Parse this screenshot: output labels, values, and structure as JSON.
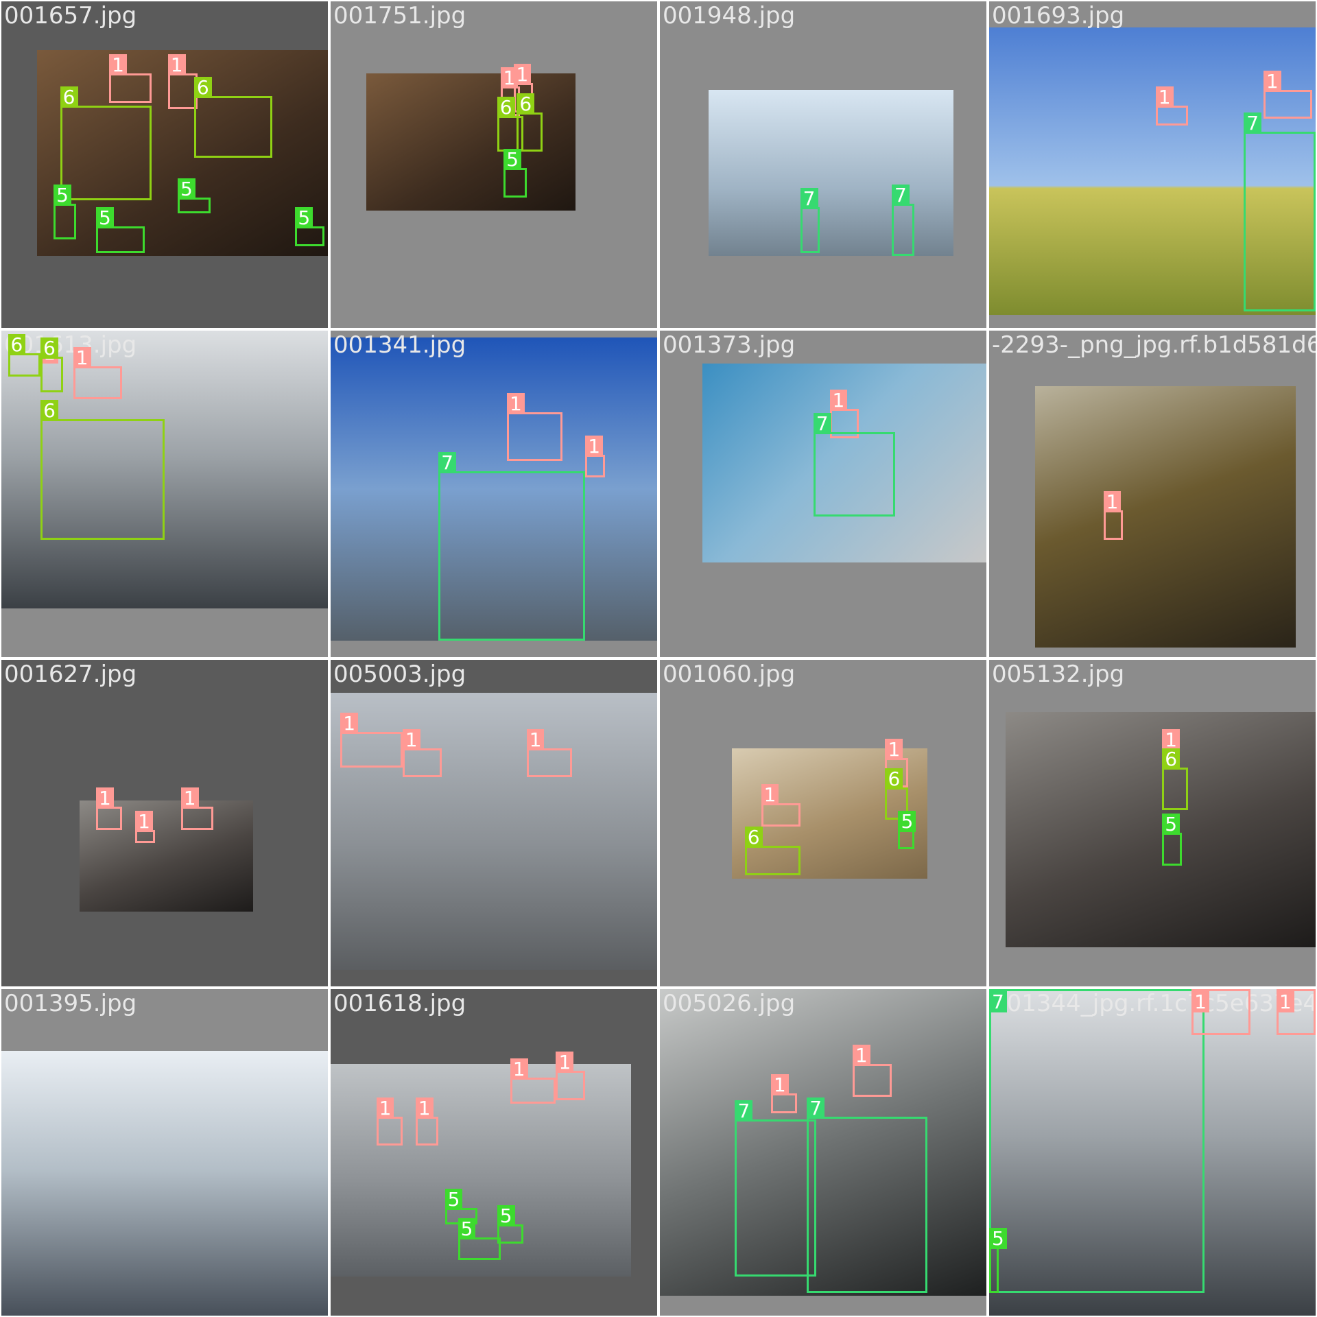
{
  "class_colors": {
    "1": "#ff9a95",
    "5": "#3ddb2e",
    "6": "#8fd114",
    "7": "#36da70"
  },
  "tiles": [
    {
      "name": "001657.jpg",
      "dark": true,
      "photo": [
        0.11,
        0.15,
        1.0,
        0.78
      ],
      "scene": "warm",
      "boxes": [
        {
          "c": "1",
          "b": [
            0.33,
            0.22,
            0.46,
            0.31
          ]
        },
        {
          "c": "1",
          "b": [
            0.51,
            0.22,
            0.6,
            0.33
          ]
        },
        {
          "c": "6",
          "b": [
            0.18,
            0.32,
            0.46,
            0.61
          ]
        },
        {
          "c": "6",
          "b": [
            0.59,
            0.29,
            0.83,
            0.48
          ]
        },
        {
          "c": "5",
          "b": [
            0.16,
            0.62,
            0.23,
            0.73
          ]
        },
        {
          "c": "5",
          "b": [
            0.29,
            0.69,
            0.44,
            0.77
          ]
        },
        {
          "c": "5",
          "b": [
            0.54,
            0.6,
            0.64,
            0.65
          ]
        },
        {
          "c": "5",
          "b": [
            0.9,
            0.69,
            0.99,
            0.75
          ]
        }
      ]
    },
    {
      "name": "001751.jpg",
      "dark": false,
      "photo": [
        0.11,
        0.22,
        0.75,
        0.64
      ],
      "scene": "warm",
      "boxes": [
        {
          "c": "1",
          "b": [
            0.52,
            0.26,
            0.58,
            0.35
          ]
        },
        {
          "c": "1",
          "b": [
            0.56,
            0.25,
            0.62,
            0.34
          ]
        },
        {
          "c": "6",
          "b": [
            0.51,
            0.35,
            0.59,
            0.46
          ]
        },
        {
          "c": "6",
          "b": [
            0.57,
            0.34,
            0.65,
            0.46
          ]
        },
        {
          "c": "5",
          "b": [
            0.53,
            0.51,
            0.6,
            0.6
          ]
        }
      ]
    },
    {
      "name": "001948.jpg",
      "dark": false,
      "photo": [
        0.15,
        0.27,
        0.9,
        0.78
      ],
      "scene": "light",
      "boxes": [
        {
          "c": "7",
          "b": [
            0.43,
            0.63,
            0.49,
            0.77
          ]
        },
        {
          "c": "7",
          "b": [
            0.71,
            0.62,
            0.78,
            0.78
          ]
        }
      ]
    },
    {
      "name": "001693.jpg",
      "dark": false,
      "photo": [
        0.0,
        0.08,
        1.0,
        0.96
      ],
      "scene": "sky",
      "boxes": [
        {
          "c": "1",
          "b": [
            0.51,
            0.32,
            0.61,
            0.38
          ]
        },
        {
          "c": "1",
          "b": [
            0.84,
            0.27,
            0.99,
            0.36
          ]
        },
        {
          "c": "7",
          "b": [
            0.78,
            0.4,
            1.0,
            0.95
          ]
        }
      ]
    },
    {
      "name": "001613.jpg",
      "dark": false,
      "photo": [
        0.0,
        0.0,
        1.0,
        0.85
      ],
      "scene": "site",
      "boxes": [
        {
          "c": "6",
          "b": [
            0.02,
            0.07,
            0.12,
            0.14
          ]
        },
        {
          "c": "1",
          "b": [
            0.12,
            0.03,
            0.17,
            0.1
          ]
        },
        {
          "c": "6",
          "b": [
            0.12,
            0.08,
            0.19,
            0.19
          ]
        },
        {
          "c": "1",
          "b": [
            0.22,
            0.11,
            0.37,
            0.21
          ]
        },
        {
          "c": "6",
          "b": [
            0.12,
            0.27,
            0.5,
            0.64
          ]
        }
      ]
    },
    {
      "name": "001341.jpg",
      "dark": false,
      "photo": [
        0.0,
        0.02,
        1.0,
        0.95
      ],
      "scene": "blue",
      "boxes": [
        {
          "c": "1",
          "b": [
            0.54,
            0.25,
            0.71,
            0.4
          ]
        },
        {
          "c": "1",
          "b": [
            0.78,
            0.38,
            0.84,
            0.45
          ]
        },
        {
          "c": "7",
          "b": [
            0.33,
            0.43,
            0.78,
            0.95
          ]
        }
      ]
    },
    {
      "name": "001373.jpg",
      "dark": false,
      "photo": [
        0.13,
        0.1,
        1.0,
        0.71
      ],
      "scene": "machine",
      "boxes": [
        {
          "c": "1",
          "b": [
            0.52,
            0.24,
            0.61,
            0.33
          ]
        },
        {
          "c": "7",
          "b": [
            0.47,
            0.31,
            0.72,
            0.57
          ]
        }
      ]
    },
    {
      "name": "-2293-_png_jpg.rf.b1d581d6",
      "dark": false,
      "photo": [
        0.14,
        0.17,
        0.94,
        0.97
      ],
      "scene": "tunnel",
      "boxes": [
        {
          "c": "1",
          "b": [
            0.35,
            0.55,
            0.41,
            0.64
          ]
        }
      ]
    },
    {
      "name": "001627.jpg",
      "dark": true,
      "photo": [
        0.24,
        0.43,
        0.77,
        0.77
      ],
      "scene": "mine",
      "boxes": [
        {
          "c": "1",
          "b": [
            0.29,
            0.45,
            0.37,
            0.52
          ]
        },
        {
          "c": "1",
          "b": [
            0.41,
            0.52,
            0.47,
            0.56
          ]
        },
        {
          "c": "1",
          "b": [
            0.55,
            0.45,
            0.65,
            0.52
          ]
        }
      ]
    },
    {
      "name": "005003.jpg",
      "dark": true,
      "photo": [
        0.0,
        0.1,
        1.0,
        0.95
      ],
      "scene": "grey",
      "boxes": [
        {
          "c": "1",
          "b": [
            0.03,
            0.22,
            0.22,
            0.33
          ]
        },
        {
          "c": "1",
          "b": [
            0.22,
            0.27,
            0.34,
            0.36
          ]
        },
        {
          "c": "1",
          "b": [
            0.6,
            0.27,
            0.74,
            0.36
          ]
        }
      ]
    },
    {
      "name": "001060.jpg",
      "dark": false,
      "photo": [
        0.22,
        0.27,
        0.82,
        0.67
      ],
      "scene": "wood",
      "boxes": [
        {
          "c": "1",
          "b": [
            0.31,
            0.44,
            0.43,
            0.51
          ]
        },
        {
          "c": "6",
          "b": [
            0.26,
            0.57,
            0.43,
            0.66
          ]
        },
        {
          "c": "1",
          "b": [
            0.69,
            0.3,
            0.76,
            0.39
          ]
        },
        {
          "c": "6",
          "b": [
            0.69,
            0.39,
            0.76,
            0.49
          ]
        },
        {
          "c": "5",
          "b": [
            0.73,
            0.52,
            0.78,
            0.58
          ]
        }
      ]
    },
    {
      "name": "005132.jpg",
      "dark": false,
      "photo": [
        0.05,
        0.16,
        1.0,
        0.88
      ],
      "scene": "mine",
      "boxes": [
        {
          "c": "1",
          "b": [
            0.53,
            0.27,
            0.58,
            0.33
          ]
        },
        {
          "c": "6",
          "b": [
            0.53,
            0.33,
            0.61,
            0.46
          ]
        },
        {
          "c": "5",
          "b": [
            0.53,
            0.53,
            0.59,
            0.63
          ]
        }
      ]
    },
    {
      "name": "001395.jpg",
      "dark": false,
      "photo": [
        0.0,
        0.19,
        1.0,
        1.0
      ],
      "scene": "ship",
      "boxes": []
    },
    {
      "name": "001618.jpg",
      "dark": true,
      "photo": [
        0.0,
        0.23,
        0.92,
        0.88
      ],
      "scene": "fog",
      "boxes": [
        {
          "c": "1",
          "b": [
            0.14,
            0.39,
            0.22,
            0.48
          ]
        },
        {
          "c": "1",
          "b": [
            0.26,
            0.39,
            0.33,
            0.48
          ]
        },
        {
          "c": "1",
          "b": [
            0.55,
            0.27,
            0.69,
            0.35
          ]
        },
        {
          "c": "1",
          "b": [
            0.69,
            0.25,
            0.78,
            0.34
          ]
        },
        {
          "c": "5",
          "b": [
            0.35,
            0.67,
            0.45,
            0.72
          ]
        },
        {
          "c": "5",
          "b": [
            0.39,
            0.76,
            0.52,
            0.83
          ]
        },
        {
          "c": "5",
          "b": [
            0.51,
            0.72,
            0.59,
            0.78
          ]
        }
      ]
    },
    {
      "name": "005026.jpg",
      "dark": false,
      "photo": [
        0.0,
        0.0,
        1.0,
        0.94
      ],
      "scene": "alley",
      "boxes": [
        {
          "c": "1",
          "b": [
            0.34,
            0.32,
            0.42,
            0.38
          ]
        },
        {
          "c": "1",
          "b": [
            0.59,
            0.23,
            0.71,
            0.33
          ]
        },
        {
          "c": "7",
          "b": [
            0.23,
            0.4,
            0.48,
            0.88
          ]
        },
        {
          "c": "7",
          "b": [
            0.45,
            0.39,
            0.82,
            0.93
          ]
        }
      ]
    },
    {
      "name": "001344_jpg.rf.1c7c5e637e4",
      "dark": false,
      "photo": [
        0.0,
        0.0,
        1.0,
        1.0
      ],
      "scene": "site",
      "boxes": [
        {
          "c": "7",
          "b": [
            0.0,
            0.0,
            0.66,
            0.93
          ]
        },
        {
          "c": "1",
          "b": [
            0.62,
            0.0,
            0.8,
            0.14
          ]
        },
        {
          "c": "1",
          "b": [
            0.88,
            0.0,
            1.0,
            0.14
          ]
        },
        {
          "c": "5",
          "b": [
            0.0,
            0.79,
            0.03,
            0.93
          ]
        }
      ]
    }
  ]
}
